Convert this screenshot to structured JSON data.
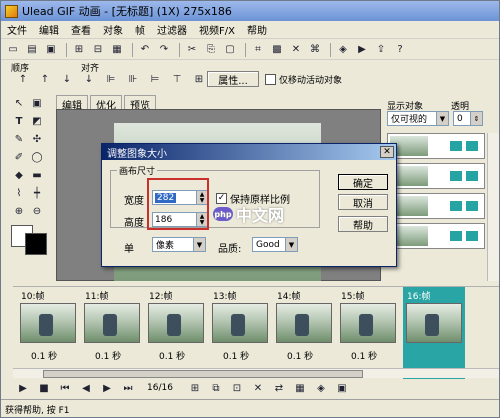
{
  "title": "Ulead GIF 动画 - [无标题] (1X) 275x186",
  "menu": [
    "文件",
    "编辑",
    "查看",
    "对象",
    "帧",
    "过滤器",
    "视频F/X",
    "帮助"
  ],
  "toolbar": {
    "sort_label": "顺序",
    "align_label": "对齐",
    "properties": "属性...",
    "only_move_active": "仅移动活动对象"
  },
  "tabs": [
    "编辑",
    "优化",
    "预览"
  ],
  "right_panel": {
    "display_label": "显示对象",
    "opacity_label": "透明",
    "display_value": "仅可视的",
    "opacity_value": "0"
  },
  "dialog": {
    "title": "调整图象大小",
    "group": "画布尺寸",
    "width_label": "宽度",
    "width_value": "282",
    "height_label": "高度",
    "height_value": "186",
    "keep_ratio": "保持原样比例",
    "unit_label": "单",
    "unit_value": "像素",
    "quality_label": "品质:",
    "quality_value": "Good",
    "ok": "确定",
    "cancel": "取消",
    "help": "帮助"
  },
  "watermark": {
    "badge": "php",
    "text": "中文网"
  },
  "frames": [
    {
      "label": "10:帧",
      "delay": "0.1 秒"
    },
    {
      "label": "11:帧",
      "delay": "0.1 秒"
    },
    {
      "label": "12:帧",
      "delay": "0.1 秒"
    },
    {
      "label": "13:帧",
      "delay": "0.1 秒"
    },
    {
      "label": "14:帧",
      "delay": "0.1 秒"
    },
    {
      "label": "15:帧",
      "delay": "0.1 秒"
    },
    {
      "label": "16:帧",
      "delay": ""
    }
  ],
  "playback": {
    "position": "16/16"
  },
  "status": "获得帮助, 按 F1",
  "colors": {
    "selected_frame": "#2aa5a5",
    "highlight_box": "#c9302c"
  }
}
